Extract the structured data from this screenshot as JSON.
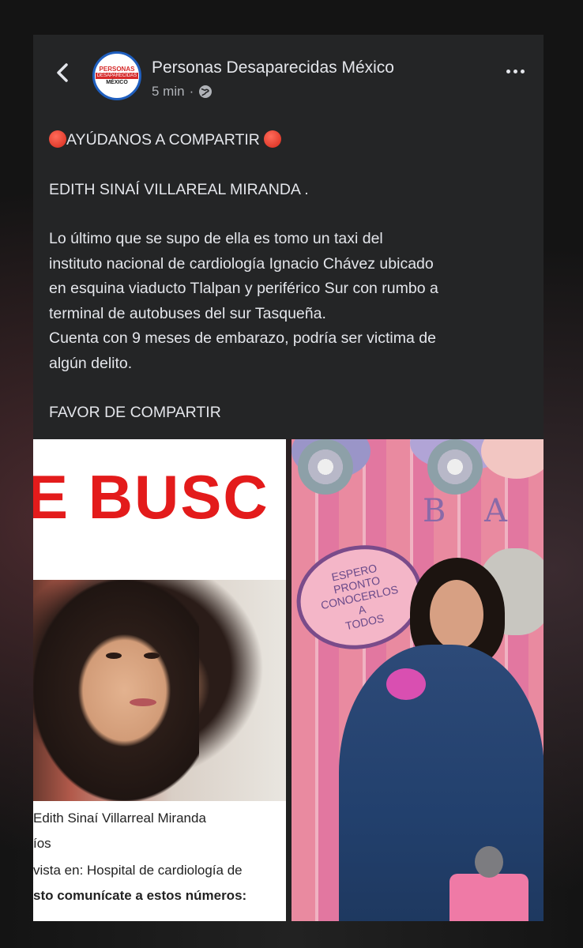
{
  "post": {
    "page_name": "Personas Desaparecidas México",
    "time": "5 min",
    "avatar_text": [
      "PERSONAS",
      "DESAPARECIDAS",
      "MÉXICO"
    ],
    "headline": "AYÚDANOS A COMPARTIR",
    "name_line": "EDITH SINAÍ VILLAREAL MIRANDA .",
    "body_lines": [
      "Lo último que se supo de ella es tomo un taxi del",
      "instituto nacional de cardiología Ignacio Chávez ubicado",
      "en esquina viaducto Tlalpan y periférico Sur con rumbo a",
      "terminal de autobuses del sur Tasqueña.",
      "Cuenta con 9 meses de embarazo, podría ser victima de",
      "algún delito."
    ],
    "footer": "FAVOR DE COMPARTIR"
  },
  "left_image": {
    "banner": "E BUSC",
    "line1": "Edith Sinaí Villarreal Miranda",
    "line2": "íos",
    "line3": "vista en: Hospital de cardiología de",
    "line4": "sto comunícate a estos números:"
  },
  "right_image": {
    "letters": "B A B",
    "bubble_text": [
      "ESPERO",
      "PRONTO",
      "CONOCERLOS",
      "A",
      "TODOS"
    ]
  },
  "colors": {
    "post_bg": "#242526",
    "text": "#e4e6eb",
    "muted": "#b0b3b8",
    "banner_red": "#e31b1b"
  },
  "icons": [
    "back-arrow-icon",
    "globe-icon",
    "more-options-icon",
    "stop-sign-icon"
  ]
}
